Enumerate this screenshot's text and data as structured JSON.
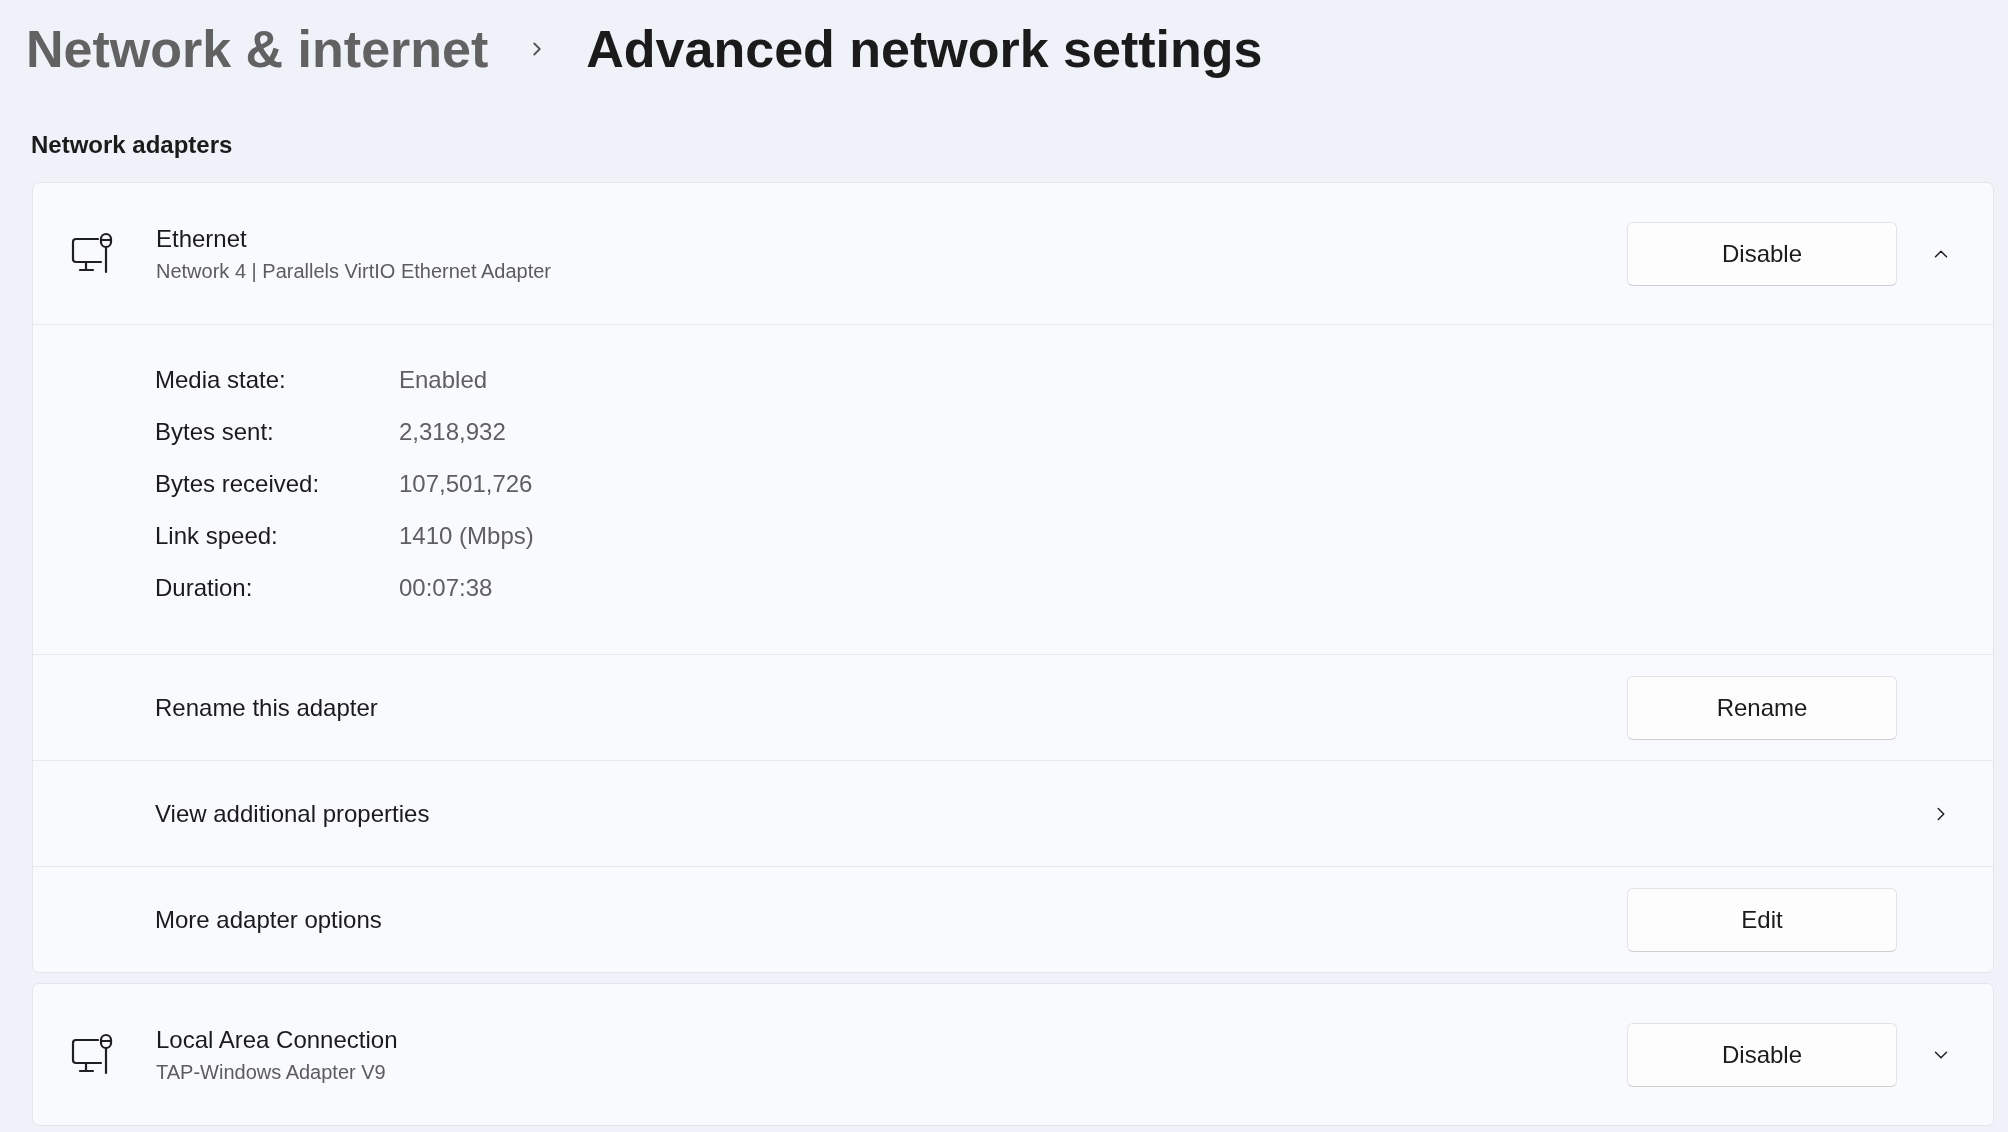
{
  "breadcrumb": [
    {
      "label": "Network & internet",
      "current": false
    },
    {
      "label": "Advanced network settings",
      "current": true
    }
  ],
  "section_title": "Network adapters",
  "adapters": [
    {
      "name": "Ethernet",
      "description": "Network 4 | Parallels VirtIO Ethernet Adapter",
      "button": "Disable",
      "expanded": true,
      "details": [
        {
          "label": "Media state:",
          "value": "Enabled"
        },
        {
          "label": "Bytes sent:",
          "value": "2,318,932"
        },
        {
          "label": "Bytes received:",
          "value": "107,501,726"
        },
        {
          "label": "Link speed:",
          "value": "1410 (Mbps)"
        },
        {
          "label": "Duration:",
          "value": "00:07:38"
        }
      ],
      "options": [
        {
          "kind": "button",
          "label": "Rename this adapter",
          "button": "Rename"
        },
        {
          "kind": "link",
          "label": "View additional properties"
        },
        {
          "kind": "button",
          "label": "More adapter options",
          "button": "Edit"
        }
      ]
    },
    {
      "name": "Local Area Connection",
      "description": "TAP-Windows Adapter V9",
      "button": "Disable",
      "expanded": false
    }
  ]
}
